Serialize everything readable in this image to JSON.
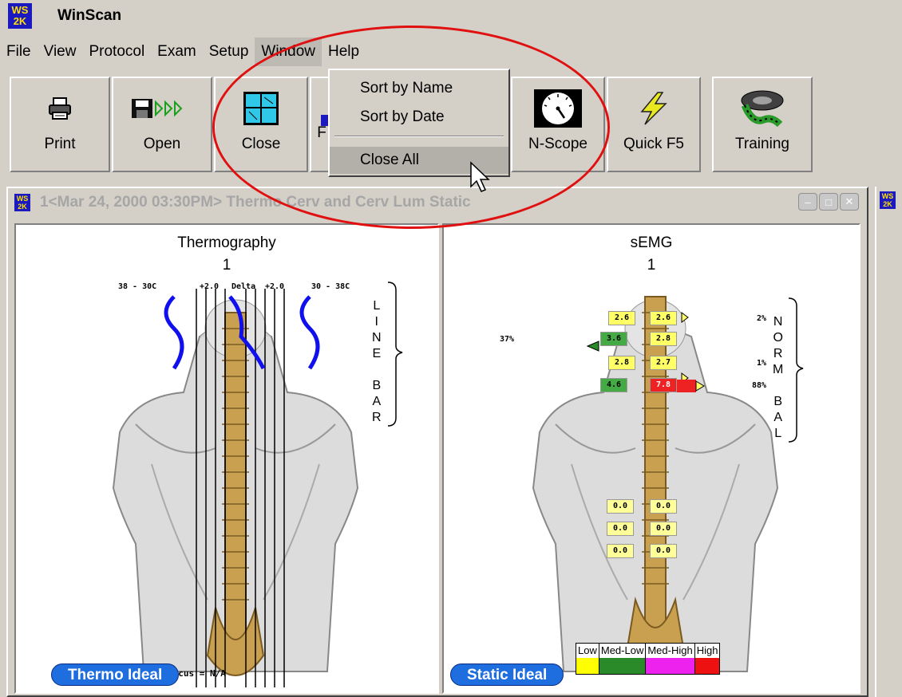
{
  "app": {
    "logo_top": "WS",
    "logo_bottom": "2K",
    "title": "WinScan"
  },
  "menu": [
    "File",
    "View",
    "Protocol",
    "Exam",
    "Setup",
    "Window",
    "Help"
  ],
  "toolbar": {
    "print": "Print",
    "open": "Open",
    "close": "Close",
    "hidden_partial": "F",
    "nscope": "N-Scope",
    "quickf5": "Quick F5",
    "training": "Training"
  },
  "window_menu": {
    "items": [
      "Sort by Name",
      "Sort by Date",
      "Close All"
    ],
    "highlighted": "Close All"
  },
  "child_window": {
    "title": "1<Mar 24, 2000 03:30PM> Thermo Cerv and Cerv Lum Static"
  },
  "thermo_pane": {
    "title": "Thermography",
    "number": "1",
    "left_range": "38 - 30C",
    "delta_left": "+2.0",
    "delta_label": "Delta",
    "delta_right": "+2.0",
    "right_range": "30 - 38C",
    "side_letters": [
      "L",
      "I",
      "N",
      "E",
      "",
      "B",
      "A",
      "R"
    ],
    "footnote": "Focus = N/A",
    "button": "Thermo Ideal"
  },
  "semg_pane": {
    "title": "sEMG",
    "number": "1",
    "side_letters": [
      "N",
      "O",
      "R",
      "M",
      "",
      "B",
      "A",
      "L"
    ],
    "rows": [
      {
        "left": "2.6",
        "right": "2.6",
        "pct_left": "",
        "pct_right": "2%"
      },
      {
        "left": "3.6",
        "right": "2.8",
        "pct_left": "37%",
        "pct_right": ""
      },
      {
        "left": "2.8",
        "right": "2.7",
        "pct_left": "",
        "pct_right": "1%"
      },
      {
        "left": "4.6",
        "right": "7.8",
        "pct_left": "",
        "pct_right": "88%"
      }
    ],
    "lumbar_rows": [
      {
        "left": "0.0",
        "right": "0.0"
      },
      {
        "left": "0.0",
        "right": "0.0"
      },
      {
        "left": "0.0",
        "right": "0.0"
      }
    ],
    "legend": [
      {
        "label": "Low",
        "color": "#ffff00"
      },
      {
        "label": "Med-Low",
        "color": "#2a8a2a"
      },
      {
        "label": "Med-High",
        "color": "#ee22ee"
      },
      {
        "label": "High",
        "color": "#ee1111"
      }
    ],
    "button": "Static Ideal"
  },
  "colors": {
    "oval": "#e01010",
    "pill": "#1f6ee0",
    "wave": "#1010ee"
  }
}
